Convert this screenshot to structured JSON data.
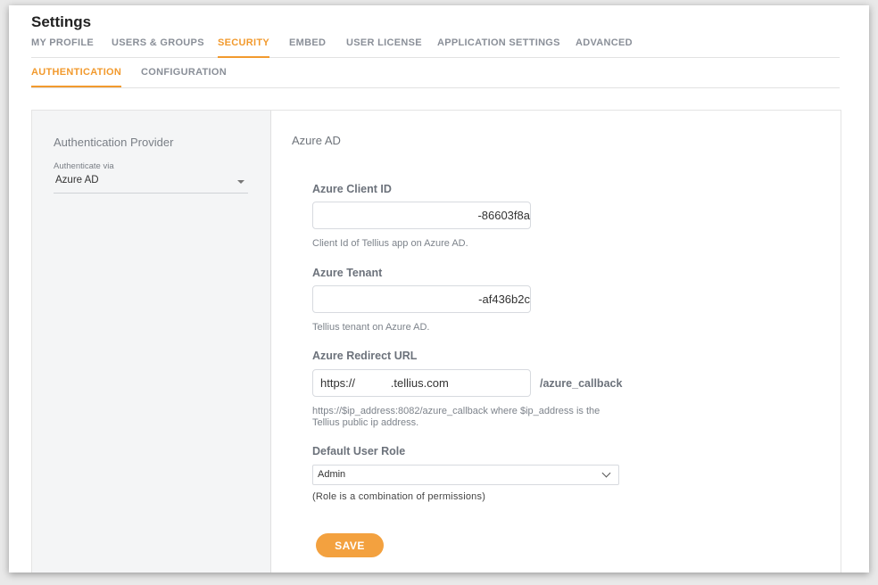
{
  "page": {
    "title": "Settings"
  },
  "main_tabs": [
    {
      "label": "MY PROFILE"
    },
    {
      "label": "USERS & GROUPS"
    },
    {
      "label": "SECURITY"
    },
    {
      "label": "EMBED"
    },
    {
      "label": "USER LICENSE"
    },
    {
      "label": "APPLICATION SETTINGS"
    },
    {
      "label": "ADVANCED"
    }
  ],
  "sub_tabs": [
    {
      "label": "AUTHENTICATION"
    },
    {
      "label": "CONFIGURATION"
    }
  ],
  "left_panel": {
    "title": "Authentication Provider",
    "authenticate_label": "Authenticate via",
    "authenticate_value": "Azure AD"
  },
  "form": {
    "title": "Azure AD",
    "client_id": {
      "label": "Azure Client ID",
      "value": "-86603f8a",
      "helper": "Client Id of Tellius app on Azure AD."
    },
    "tenant": {
      "label": "Azure Tenant",
      "value": "-af436b2c",
      "helper": "Tellius tenant on Azure AD."
    },
    "redirect": {
      "label": "Azure Redirect URL",
      "value": "https://           .tellius.com",
      "suffix": "/azure_callback",
      "helper_line1": "https://$ip_address:8082/azure_callback where $ip_address is the",
      "helper_line2": "Tellius public ip address."
    },
    "role": {
      "label": "Default User Role",
      "value": "Admin",
      "helper": "(Role is a combination of permissions)"
    },
    "save_label": "SAVE"
  },
  "colors": {
    "accent": "#f29a2e",
    "save_button": "#f3a13f"
  }
}
